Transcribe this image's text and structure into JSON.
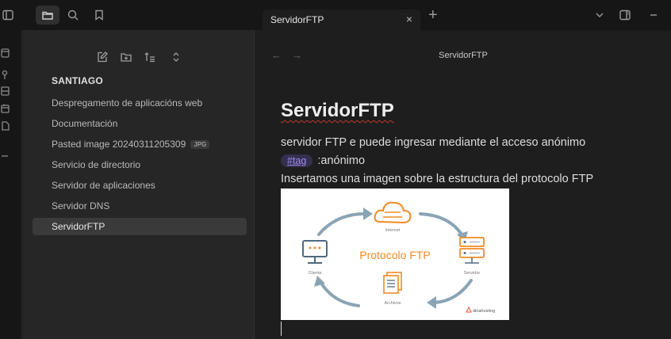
{
  "tab": {
    "title": "ServidorFTP",
    "close": "×",
    "add": "+"
  },
  "icons": {
    "ribbon_toggle": "sidebar-toggle-icon",
    "files": "folder-icon",
    "search": "search-icon",
    "bookmarks": "bookmark-icon",
    "new_note": "new-note-icon",
    "new_folder": "new-folder-icon",
    "sort": "sort-icon",
    "collapse": "expand-collapse-icon"
  },
  "sidebar": {
    "vault_name": "SANTIAGO",
    "items": [
      {
        "label": "Despregamento de aplicacións web",
        "ext": ""
      },
      {
        "label": "Documentación",
        "ext": ""
      },
      {
        "label": "Pasted image 20240311205309",
        "ext": "JPG"
      },
      {
        "label": "Servicio de directorio",
        "ext": ""
      },
      {
        "label": "Servidor de aplicaciones",
        "ext": ""
      },
      {
        "label": "Servidor DNS",
        "ext": ""
      },
      {
        "label": "ServidorFTP",
        "ext": "",
        "active": true
      }
    ]
  },
  "editor": {
    "header_title": "ServidorFTP",
    "note_title": "ServidorFTP",
    "line1": "servidor FTP e puede ingresar mediante el acceso anónimo",
    "tag": "#tag",
    "line2_rest": " :anónimo",
    "line3": "Insertamos una imagen sobre la estructura del protocolo FTP"
  },
  "diagram": {
    "center_label": "Protocolo FTP",
    "internet": "Internet",
    "cliente": "Cliente",
    "servidor": "Servidor",
    "archivos": "Archivos",
    "brand": "dinahosting"
  },
  "colors": {
    "accent_orange": "#f08a24",
    "arrow_blue": "#8aa4b5",
    "tag_text": "#9f8cf0",
    "tag_bg": "#352f4f"
  }
}
